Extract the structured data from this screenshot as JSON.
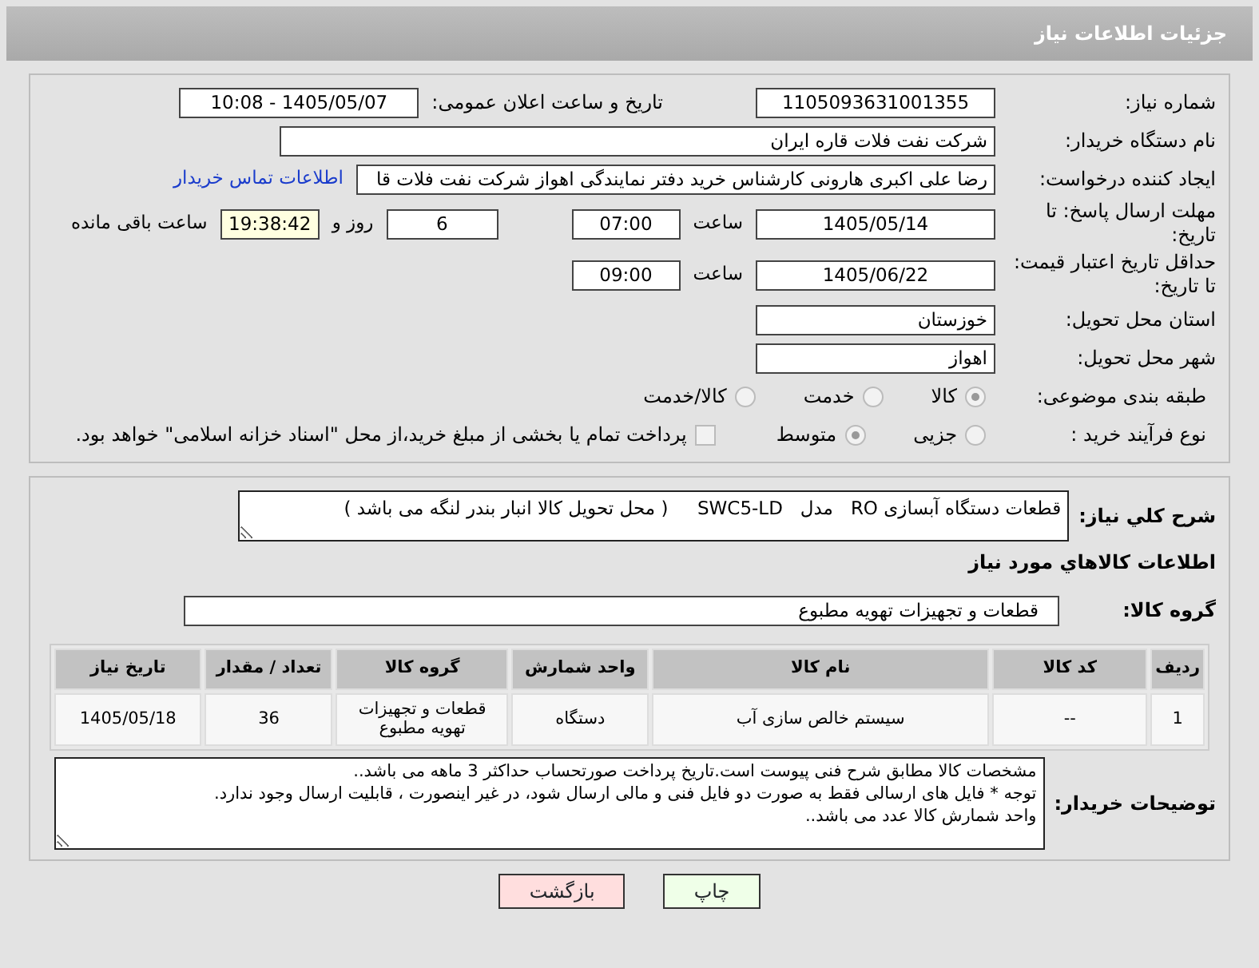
{
  "header": {
    "title": "جزئیات اطلاعات نیاز"
  },
  "need_number": {
    "label": "شماره نیاز:",
    "value": "1105093631001355"
  },
  "announce": {
    "label": "تاریخ و ساعت اعلان عمومی:",
    "value": "1405/05/07 - 10:08"
  },
  "buyer": {
    "label": "نام دستگاه خریدار:",
    "value": "شرکت نفت فلات قاره ایران"
  },
  "creator": {
    "label": "ایجاد کننده درخواست:",
    "value": "رضا علی اکبری هارونی کارشناس خرید دفتر نمایندگی اهواز شرکت نفت فلات قا",
    "link": "اطلاعات تماس خریدار"
  },
  "deadline": {
    "label": "مهلت ارسال پاسخ: تا تاریخ:",
    "date": "1405/05/14",
    "time_label": "ساعت",
    "time": "07:00",
    "days": "6",
    "days_label": "روز و",
    "remaining": "19:38:42",
    "remaining_label": "ساعت باقی مانده"
  },
  "validity": {
    "label": "حداقل تاریخ اعتبار قیمت: تا تاریخ:",
    "date": "1405/06/22",
    "time_label": "ساعت",
    "time": "09:00"
  },
  "province": {
    "label": "استان محل تحویل:",
    "value": "خوزستان"
  },
  "city": {
    "label": "شهر محل تحویل:",
    "value": "اهواز"
  },
  "category": {
    "label": "طبقه بندی موضوعی:",
    "options": [
      {
        "label": "کالا",
        "selected": true
      },
      {
        "label": "خدمت",
        "selected": false
      },
      {
        "label": "کالا/خدمت",
        "selected": false
      }
    ]
  },
  "process": {
    "label": "نوع فرآیند خرید :",
    "options": [
      {
        "label": "جزیی",
        "selected": false
      },
      {
        "label": "متوسط",
        "selected": true
      }
    ],
    "checkbox": {
      "label": "پرداخت تمام یا بخشی از مبلغ خرید،از محل \"اسناد خزانه اسلامی\" خواهد بود.",
      "checked": false
    }
  },
  "description": {
    "label": "شرح کلي نياز:",
    "value": "قطعات دستگاه آبسازی RO   مدل   SWC5-LD     ( محل تحویل کالا انبار بندر لنگه می باشد )"
  },
  "goods_title": "اطلاعات کالاهاي مورد نياز",
  "goods_group": {
    "label": "گروه کالا:",
    "value": "قطعات و تجهیزات تهویه مطبوع"
  },
  "table": {
    "columns": [
      "ردیف",
      "کد کالا",
      "نام کالا",
      "واحد شمارش",
      "گروه کالا",
      "تعداد / مقدار",
      "تاریخ نیاز"
    ],
    "rows": [
      [
        "1",
        "--",
        "سیستم خالص سازی آب",
        "دستگاه",
        "قطعات و تجهیزات تهویه مطبوع",
        "36",
        "1405/05/18"
      ]
    ]
  },
  "notes": {
    "label": "توضیحات خریدار:",
    "lines": [
      "مشخصات کالا مطابق شرح فنی پیوست است.تاریخ پرداخت صورتحساب حداکثر 3 ماهه می باشد..",
      "توجه * فایل های ارسالی فقط به صورت دو فایل فنی و مالی ارسال شود، در غیر اینصورت ، قابلیت ارسال وجود ندارد.",
      "واحد شمارش کالا عدد می باشد.."
    ]
  },
  "buttons": [
    {
      "label": "چاپ",
      "kind": "print"
    },
    {
      "label": "بازگشت",
      "kind": "back"
    }
  ]
}
